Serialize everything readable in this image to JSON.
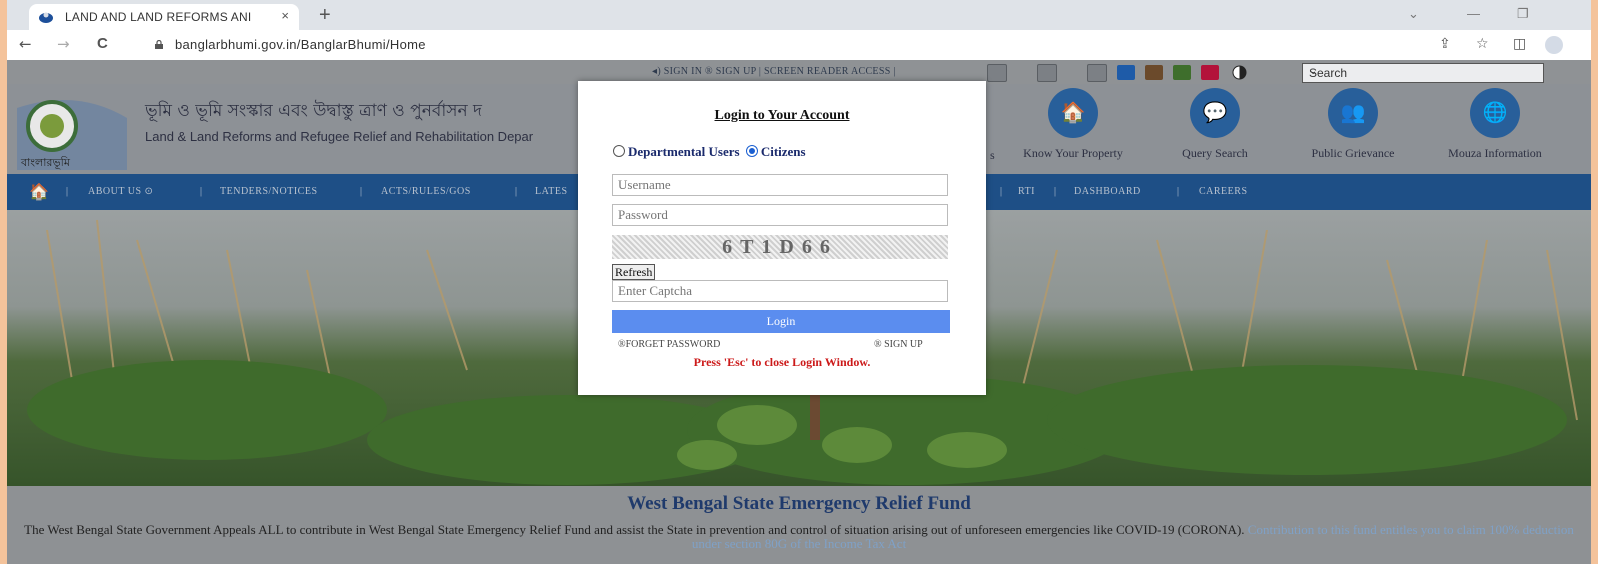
{
  "browser": {
    "tab_title": "LAND AND LAND REFORMS ANI",
    "tab_close": "×",
    "new_tab": "+",
    "url": "banglarbhumi.gov.in/BanglarBhumi/Home",
    "back": "←",
    "forward": "→",
    "reload": "C",
    "share": "⇪",
    "bookmark": "☆",
    "sidebar": "◫",
    "minimize": "—",
    "restore": "❐",
    "win_dropdown": "⌄"
  },
  "util_bar": {
    "links": "◂) SIGN IN  ® SIGN UP  |  SCREEN READER ACCESS  |",
    "search_placeholder": "Search",
    "search_dropdown": "⌄",
    "theme_colors": [
      "#1e5ba8",
      "#6b4a2b",
      "#3e6e2c",
      "#b3123a"
    ]
  },
  "header": {
    "dept_bengali": "ভূমি ও ভূমি সংস্কার এবং উদ্বাস্তু ত্রাণ ও পুনর্বাসন দ",
    "dept_english": "Land & Land Reforms and Refugee Relief and Rehabilitation Depar",
    "logo_text": "বাংলারভূমি",
    "quick_links": [
      {
        "label": "Know Your Property",
        "icon": "🏠"
      },
      {
        "label": "Query Search",
        "icon": "💬"
      },
      {
        "label": "Public Grievance",
        "icon": "👥"
      },
      {
        "label": "Mouza Information",
        "icon": "🌐"
      }
    ],
    "partial_label": "s"
  },
  "nav": {
    "home_icon": "🏠",
    "items": [
      "ABOUT US ⊙",
      "TENDERS/NOTICES",
      "ACTS/RULES/GOS",
      "LATES",
      "RTI",
      "DASHBOARD",
      "CAREERS"
    ],
    "separators": [
      "|",
      "|",
      "|",
      "|",
      "|",
      "|",
      "|"
    ]
  },
  "fund": {
    "title": "West Bengal State Emergency Relief Fund",
    "text_main": "The West Bengal State Government Appeals ALL to contribute in West Bengal State Emergency Relief Fund and assist the State in prevention and control of situation arising out of unforeseen emergencies like COVID-19 (CORONA).",
    "text_highlight": "Contribution to this fund entitles you to claim 100% deduction under section 80G of the Income Tax Act"
  },
  "login": {
    "title": "Login to Your Account",
    "radio_departmental": "Departmental Users",
    "radio_citizens": "Citizens",
    "username_placeholder": "Username",
    "password_placeholder": "Password",
    "captcha_text": "6T1D66",
    "refresh_label": "Refresh",
    "captcha_placeholder": "Enter Captcha",
    "login_button": "Login",
    "forget_password": "®FORGET PASSWORD",
    "sign_up": "® SIGN UP",
    "esc_note": "Press 'Esc' to close Login Window."
  }
}
